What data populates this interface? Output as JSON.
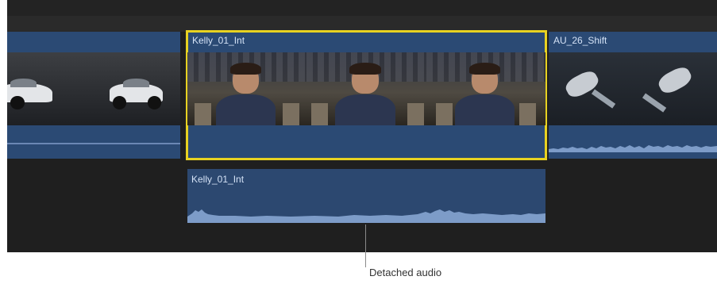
{
  "clips": {
    "left": {
      "name": ""
    },
    "center": {
      "name": "Kelly_01_Int"
    },
    "right": {
      "name": "AU_26_Shift"
    }
  },
  "audio_clip": {
    "name": "Kelly_01_Int"
  },
  "annotations": {
    "detached_audio": "Detached audio"
  },
  "colors": {
    "timeline_bg": "#1f1f1f",
    "clip_blue": "#2b4a74",
    "selection_yellow": "#e8d221",
    "clip_text": "#d4e2f6"
  }
}
